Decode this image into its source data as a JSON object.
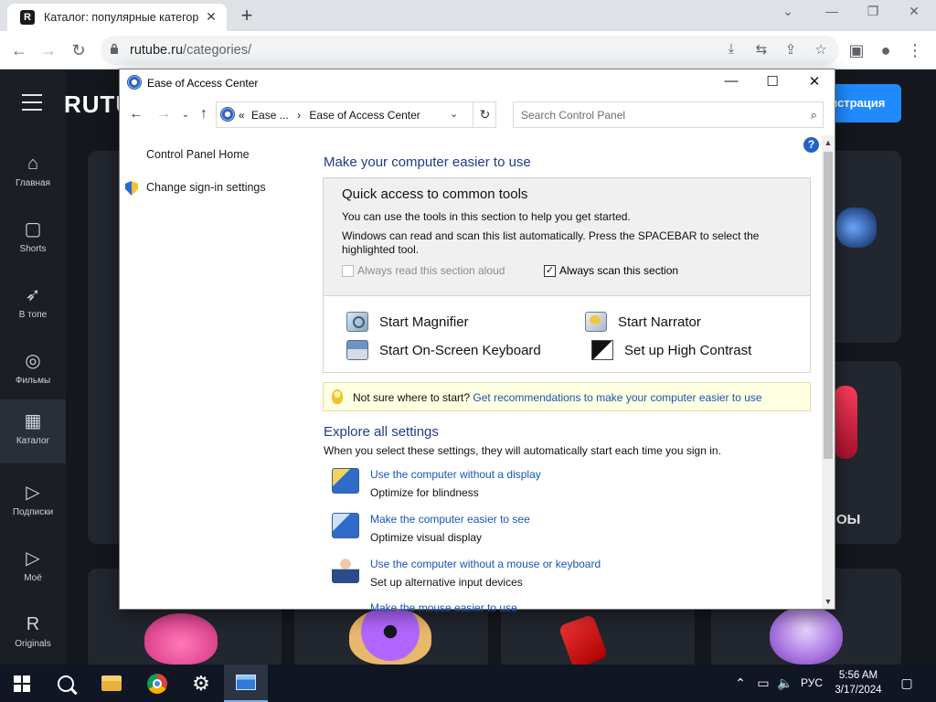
{
  "browser": {
    "tab_title": "Каталог: популярные категории",
    "url_host": "rutube.ru",
    "url_path": "/categories/"
  },
  "rutube": {
    "logo": "RUTUBE",
    "register_label": "Регистрация",
    "register_visible": "истрация",
    "category_partial": "ОЫ",
    "nav": [
      {
        "icon": "home-icon",
        "glyph": "⌂",
        "label": "Главная"
      },
      {
        "icon": "shorts-icon",
        "glyph": "▢",
        "label": "Shorts"
      },
      {
        "icon": "rocket-icon",
        "glyph": "➶",
        "label": "В топе"
      },
      {
        "icon": "film-icon",
        "glyph": "◎",
        "label": "Фильмы"
      },
      {
        "icon": "catalog-icon",
        "glyph": "▦",
        "label": "Каталог"
      },
      {
        "icon": "subscriptions-icon",
        "glyph": "▷",
        "label": "Подписки"
      },
      {
        "icon": "my-icon",
        "glyph": "▷",
        "label": "Моё"
      },
      {
        "icon": "originals-icon",
        "glyph": "R",
        "label": "Originals"
      }
    ]
  },
  "cp": {
    "window_title": "Ease of Access Center",
    "address": {
      "prefix": "«",
      "crumb1": "Ease ...",
      "sep": "›",
      "crumb2": "Ease of Access Center"
    },
    "search_placeholder": "Search Control Panel",
    "left_links": {
      "home": "Control Panel Home",
      "signin": "Change sign-in settings"
    },
    "heading": "Make your computer easier to use",
    "quick_access": {
      "title": "Quick access to common tools",
      "p1": "You can use the tools in this section to help you get started.",
      "p2": "Windows can read and scan this list automatically.  Press the SPACEBAR to select the",
      "p3": "highlighted tool.",
      "cb_read": "Always read this section aloud",
      "cb_scan": "Always scan this section",
      "cb_scan_mark": "✓"
    },
    "tools": {
      "magnifier": "Start Magnifier",
      "narrator": "Start Narrator",
      "keyboard": "Start On-Screen Keyboard",
      "contrast": "Set up High Contrast"
    },
    "tip": {
      "text": "Not sure where to start?",
      "link": "Get recommendations to make your computer easier to use"
    },
    "explore": {
      "heading": "Explore all settings",
      "desc": "When you select these settings, they will automatically start each time you sign in.",
      "items": [
        {
          "link": "Use the computer without a display",
          "sub": "Optimize for blindness"
        },
        {
          "link": "Make the computer easier to see",
          "sub": "Optimize visual display"
        },
        {
          "link": "Use the computer without a mouse or keyboard",
          "sub": "Set up alternative input devices"
        },
        {
          "link": "Make the mouse easier to use",
          "sub": ""
        }
      ]
    },
    "help_glyph": "?"
  },
  "taskbar": {
    "lang": "РУС",
    "time": "5:56 AM",
    "date": "3/17/2024"
  }
}
